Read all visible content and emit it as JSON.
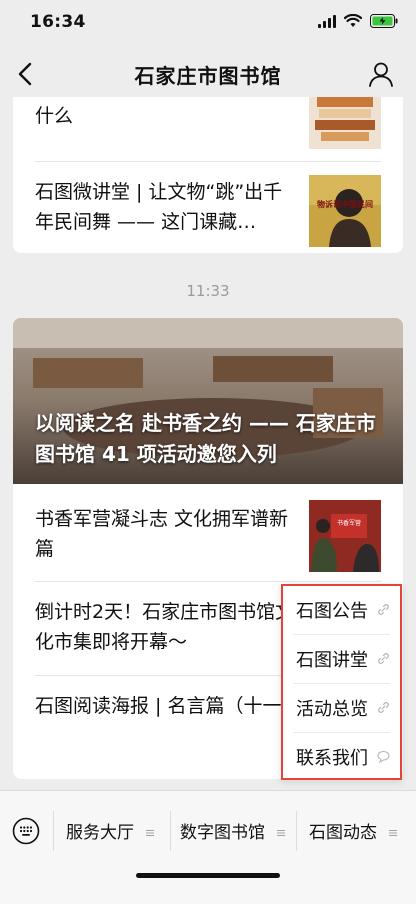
{
  "status_bar": {
    "time": "16:34"
  },
  "nav": {
    "title": "石家庄市图书馆"
  },
  "chat": {
    "card1": {
      "items": [
        {
          "title": "什么",
          "thumb": "books-stack-image"
        },
        {
          "title": "石图微讲堂 | 让文物“跳”出千年民间舞 —— 这门课藏…",
          "thumb_caption": "物诉说中国民间"
        }
      ]
    },
    "timestamp": "11:33",
    "card2": {
      "hero_title": "以阅读之名 赴书香之约 —— 石家庄市图书馆 41 项活动邀您入列",
      "items": [
        {
          "title": "书香军营凝斗志 文化拥军谱新篇",
          "thumb_caption": "书香军营"
        },
        {
          "title": "倒计时2天！石家庄市图书馆文化市集即将开幕～"
        },
        {
          "title": "石图阅读海报 | 名言篇（十一）"
        }
      ]
    }
  },
  "popup_menu": {
    "items": [
      {
        "label": "石图公告",
        "icon": "link-icon"
      },
      {
        "label": "石图讲堂",
        "icon": "link-icon"
      },
      {
        "label": "活动总览",
        "icon": "link-icon"
      },
      {
        "label": "联系我们",
        "icon": "chat-bubble-icon"
      }
    ]
  },
  "bottom_menu": {
    "items": [
      {
        "label": "服务大厅"
      },
      {
        "label": "数字图书馆"
      },
      {
        "label": "石图动态"
      }
    ]
  },
  "colors": {
    "accent_border": "#e0453a",
    "background": "#ededed"
  }
}
